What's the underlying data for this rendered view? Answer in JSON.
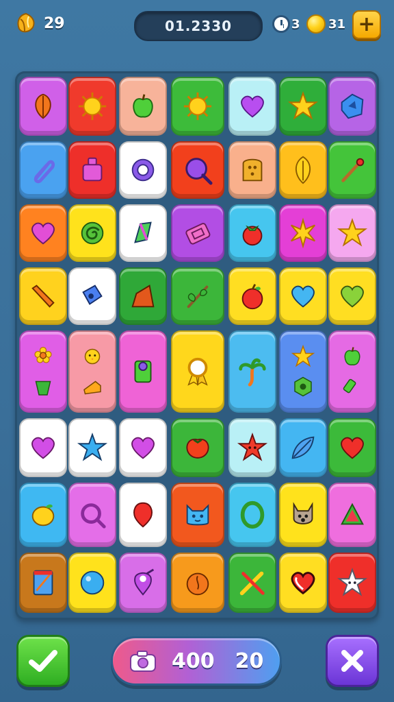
{
  "hud": {
    "lives": "29",
    "timer": "01.2330",
    "clock_value": "3",
    "coins": "31",
    "plus_label": "+"
  },
  "colors": {
    "background": "#3a6f99",
    "board": "#2f5c80"
  },
  "board": {
    "rows": [
      [
        {
          "bg": "#d060e8",
          "icons": [
            "leaf"
          ]
        },
        {
          "bg": "#f03a2c",
          "icons": [
            "sun"
          ]
        },
        {
          "bg": "#f7b39a",
          "icons": [
            "apple-green"
          ]
        },
        {
          "bg": "#3dbb3a",
          "icons": [
            "sun"
          ]
        },
        {
          "bg": "#b9f0f6",
          "icons": [
            "heart-purple"
          ]
        },
        {
          "bg": "#2fae3a",
          "icons": [
            "star-yellow"
          ]
        },
        {
          "bg": "#b664e6",
          "icons": [
            "gem-blue"
          ]
        }
      ],
      [
        {
          "bg": "#4aa2f0",
          "icons": [
            "paperclip"
          ]
        },
        {
          "bg": "#ee2f2a",
          "icons": [
            "bottle"
          ]
        },
        {
          "bg": "#ffffff",
          "icons": [
            "ring-purple"
          ]
        },
        {
          "bg": "#f2401c",
          "icons": [
            "magnifier"
          ]
        },
        {
          "bg": "#f9b08c",
          "icons": [
            "toast"
          ]
        },
        {
          "bg": "#ffbf1c",
          "icons": [
            "leaf-yellow"
          ]
        },
        {
          "bg": "#44c43a",
          "icons": [
            "pencil"
          ]
        }
      ],
      [
        {
          "bg": "#ff8220",
          "icons": [
            "heart-pink"
          ]
        },
        {
          "bg": "#ffe21c",
          "icons": [
            "swirl"
          ]
        },
        {
          "bg": "#ffffff",
          "icons": [
            "crystal"
          ]
        },
        {
          "bg": "#b24ee4",
          "icons": [
            "ticket"
          ]
        },
        {
          "bg": "#46c6ef",
          "icons": [
            "tomato"
          ]
        },
        {
          "bg": "#e43fd6",
          "icons": [
            "burst"
          ]
        },
        {
          "bg": "#f5a8ef",
          "icons": [
            "star-yellow"
          ]
        }
      ],
      [
        {
          "bg": "#ffd21e",
          "icons": [
            "sausage"
          ]
        },
        {
          "bg": "#ffffff",
          "icons": [
            "sharpener"
          ]
        },
        {
          "bg": "#2fa838",
          "icons": [
            "wedge"
          ]
        },
        {
          "bg": "#3cb63a",
          "icons": [
            "twig"
          ]
        },
        {
          "bg": "#ffde22",
          "icons": [
            "apple-red"
          ]
        },
        {
          "bg": "#ffde22",
          "icons": [
            "heart-blue"
          ]
        },
        {
          "bg": "#ffde22",
          "icons": [
            "heart-green"
          ]
        }
      ],
      [
        {
          "bg": "#e05ee6",
          "icons": [
            "flower",
            "pot"
          ]
        },
        {
          "bg": "#f79aa6",
          "icons": [
            "chick",
            "cheese"
          ]
        },
        {
          "bg": "#ef63d6",
          "icons": [
            "lantern"
          ]
        },
        {
          "bg": "#ffd71c",
          "icons": [
            "medal"
          ]
        },
        {
          "bg": "#4cbcf0",
          "icons": [
            "palm"
          ]
        },
        {
          "bg": "#5a8ef0",
          "icons": [
            "star-yellow",
            "hexagon"
          ]
        },
        {
          "bg": "#e56ae4",
          "icons": [
            "apple-green",
            "tube"
          ]
        }
      ],
      [
        {
          "bg": "#ffffff",
          "icons": [
            "heart-magenta"
          ]
        },
        {
          "bg": "#ffffff",
          "icons": [
            "star-blue"
          ]
        },
        {
          "bg": "#ffffff",
          "icons": [
            "heart-magenta"
          ]
        },
        {
          "bg": "#3cb63a",
          "icons": [
            "tomato-big"
          ]
        },
        {
          "bg": "#b9f0f6",
          "icons": [
            "star-red"
          ]
        },
        {
          "bg": "#44b6f2",
          "icons": [
            "leaf-blue"
          ]
        },
        {
          "bg": "#3cba3a",
          "icons": [
            "heart-red"
          ]
        }
      ],
      [
        {
          "bg": "#3fb8f2",
          "icons": [
            "lemon"
          ]
        },
        {
          "bg": "#e46ee8",
          "icons": [
            "magnifier-pink"
          ]
        },
        {
          "bg": "#ffffff",
          "icons": [
            "balloon"
          ]
        },
        {
          "bg": "#f2581e",
          "icons": [
            "cat"
          ]
        },
        {
          "bg": "#46c6ef",
          "icons": [
            "ring-green"
          ]
        },
        {
          "bg": "#ffe21c",
          "icons": [
            "dog"
          ]
        },
        {
          "bg": "#ef6ede",
          "icons": [
            "watermelon"
          ]
        }
      ],
      [
        {
          "bg": "#c8781c",
          "icons": [
            "notebook"
          ]
        },
        {
          "bg": "#ffe21c",
          "icons": [
            "ball-blue"
          ]
        },
        {
          "bg": "#d86ee8",
          "icons": [
            "pin"
          ]
        },
        {
          "bg": "#f79a1c",
          "icons": [
            "peach"
          ]
        },
        {
          "bg": "#3cb63a",
          "icons": [
            "crossed-pencils"
          ]
        },
        {
          "bg": "#ffde22",
          "icons": [
            "heart-outline"
          ]
        },
        {
          "bg": "#ef2f2a",
          "icons": [
            "ghost-star"
          ]
        }
      ]
    ]
  },
  "bottom": {
    "left_button_icon": "checkmark-icon",
    "right_button_icon": "close-icon",
    "score": "400",
    "moves": "20"
  }
}
